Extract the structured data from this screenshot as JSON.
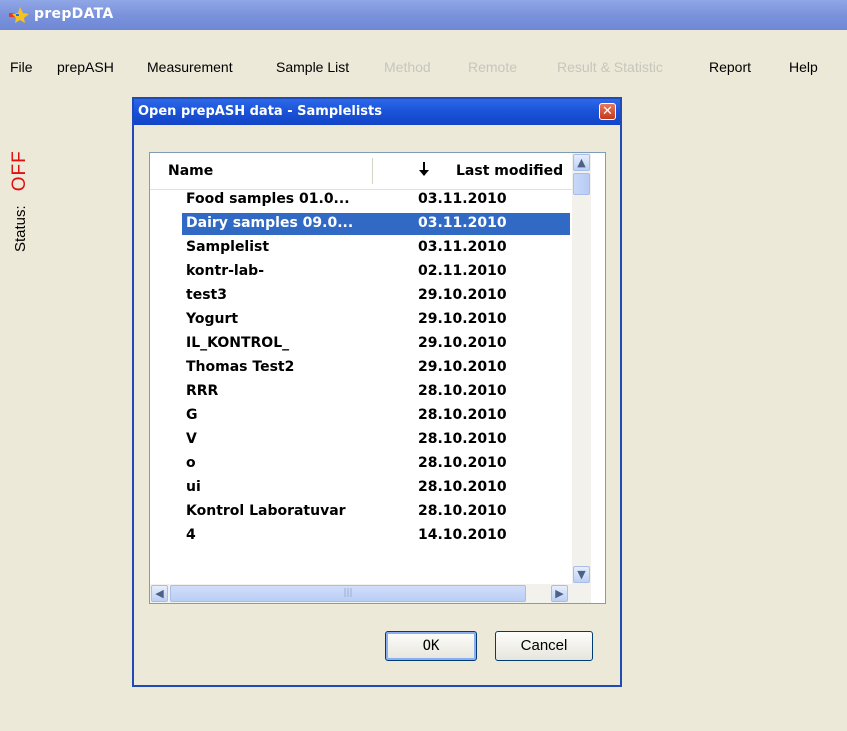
{
  "app": {
    "title": "prepDATA"
  },
  "menu": {
    "items": [
      {
        "label": "File",
        "enabled": true
      },
      {
        "label": "prepASH",
        "enabled": true
      },
      {
        "label": "Measurement",
        "enabled": true
      },
      {
        "label": "Sample List",
        "enabled": true
      },
      {
        "label": "Method",
        "enabled": false
      },
      {
        "label": "Remote",
        "enabled": false
      },
      {
        "label": "Result & Statistic",
        "enabled": false
      },
      {
        "label": "Report",
        "enabled": true
      },
      {
        "label": "Help",
        "enabled": true
      }
    ]
  },
  "status": {
    "label": "Status:",
    "value": "OFF",
    "value_color": "#e01010"
  },
  "dialog": {
    "title": "Open prepASH data - Samplelists",
    "close_glyph": "✕",
    "columns": {
      "name": "Name",
      "sort_arrow": "🠗",
      "modified": "Last modified"
    },
    "rows": [
      {
        "name": "Food samples 01.0...",
        "modified": "03.11.2010"
      },
      {
        "name": "Dairy samples 09.0...",
        "modified": "03.11.2010",
        "selected": true
      },
      {
        "name": "Samplelist",
        "modified": "03.11.2010"
      },
      {
        "name": "kontr-lab-",
        "modified": "02.11.2010"
      },
      {
        "name": "test3",
        "modified": "29.10.2010"
      },
      {
        "name": "Yogurt",
        "modified": "29.10.2010"
      },
      {
        "name": "IL_KONTROL_",
        "modified": "29.10.2010"
      },
      {
        "name": "Thomas Test2",
        "modified": "29.10.2010"
      },
      {
        "name": "RRR",
        "modified": "28.10.2010"
      },
      {
        "name": "G",
        "modified": "28.10.2010"
      },
      {
        "name": "V",
        "modified": "28.10.2010"
      },
      {
        "name": "o",
        "modified": "28.10.2010"
      },
      {
        "name": "ui",
        "modified": "28.10.2010"
      },
      {
        "name": "Kontrol Laboratuvar",
        "modified": "28.10.2010"
      },
      {
        "name": "4",
        "modified": "14.10.2010"
      }
    ],
    "ok_label": "OK",
    "cancel_label": "Cancel"
  },
  "colors": {
    "selection": "#316ac5",
    "dialog_border": "#1f4bb8",
    "window_bg": "#ece9d8"
  }
}
